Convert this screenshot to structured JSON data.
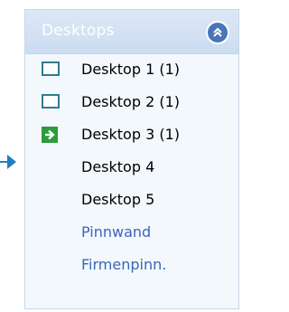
{
  "panel": {
    "title": "Desktops",
    "collapse_icon": "double-chevron-up-icon"
  },
  "desktops": [
    {
      "label": "Desktop 1 (1)",
      "icon": "monitor-icon"
    },
    {
      "label": "Desktop 2 (1)",
      "icon": "monitor-icon"
    },
    {
      "label": "Desktop 3 (1)",
      "icon": "green-arrow-right-icon",
      "current": true
    },
    {
      "label": "Desktop 4",
      "icon": ""
    },
    {
      "label": "Desktop 5",
      "icon": ""
    }
  ],
  "links": [
    {
      "label": "Pinnwand"
    },
    {
      "label": "Firmenpinn."
    }
  ],
  "colors": {
    "accent": "#3a66b8",
    "current_icon": "#2e9a3c",
    "monitor_border": "#2e7d8c",
    "pointer": "#1f7fc4"
  }
}
